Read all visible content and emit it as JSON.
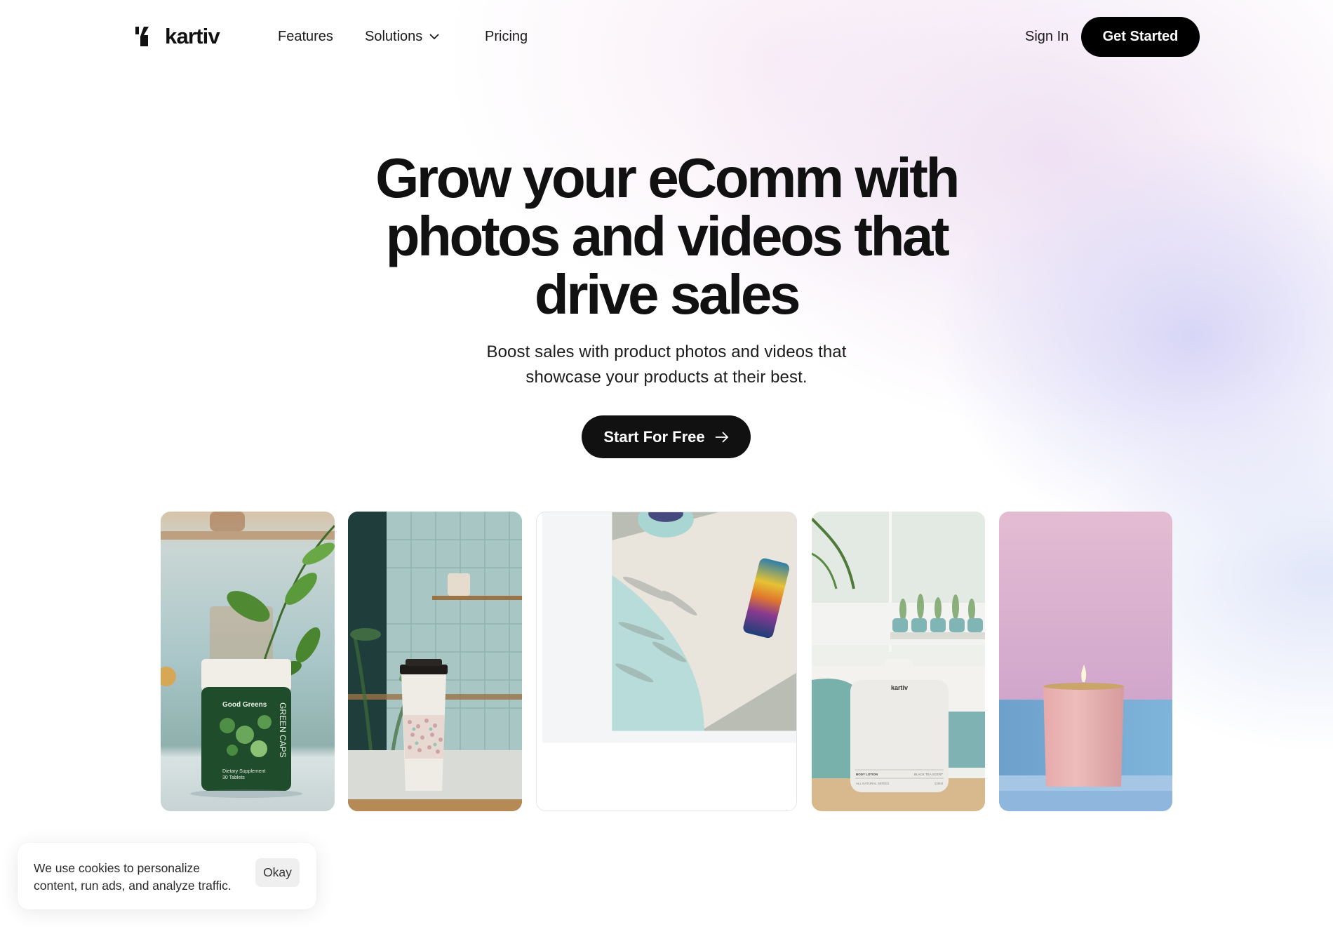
{
  "brand": {
    "name": "kartiv",
    "logo_icon": "kartiv-logo-mark",
    "accent": "#000000"
  },
  "nav": {
    "items": [
      {
        "label": "Features"
      },
      {
        "label": "Solutions",
        "icon": "chevron-down-icon"
      },
      {
        "label": "Pricing"
      }
    ],
    "sign_in": "Sign In",
    "get_started": "Get Started"
  },
  "hero": {
    "title_lines": [
      "Grow your eComm with",
      "photos and videos that",
      "drive sales"
    ],
    "subtitle_lines": [
      "Boost sales with product photos and videos that",
      "showcase your products at their best."
    ],
    "cta_label": "Start For Free",
    "cta_icon": "arrow-right-icon"
  },
  "gallery": {
    "cards": [
      {
        "alt": "Good Greens supplement jar on kitchen counter with plant",
        "brand": "Good Greens",
        "product": "GREEN CAPS",
        "line1": "Dietary Supplement",
        "line2": "30 Tablets"
      },
      {
        "alt": "Takeaway coffee cup with patterned sleeve in cafe"
      },
      {
        "alt": "Iridescent drink can on table with leaf shadows"
      },
      {
        "alt": "kartiv body lotion bottle in bathroom",
        "brand": "kartiv",
        "product": "BODY LOTION",
        "scent": "BLACK TEA SCENT",
        "series": "ALL NATURAL SERIES",
        "volume": "140ml"
      },
      {
        "alt": "Pink candle against pink and blue wall"
      }
    ]
  },
  "cookie_banner": {
    "text_lines": [
      "We use cookies to personalize",
      "content, run ads, and analyze traffic."
    ],
    "button": "Okay"
  }
}
